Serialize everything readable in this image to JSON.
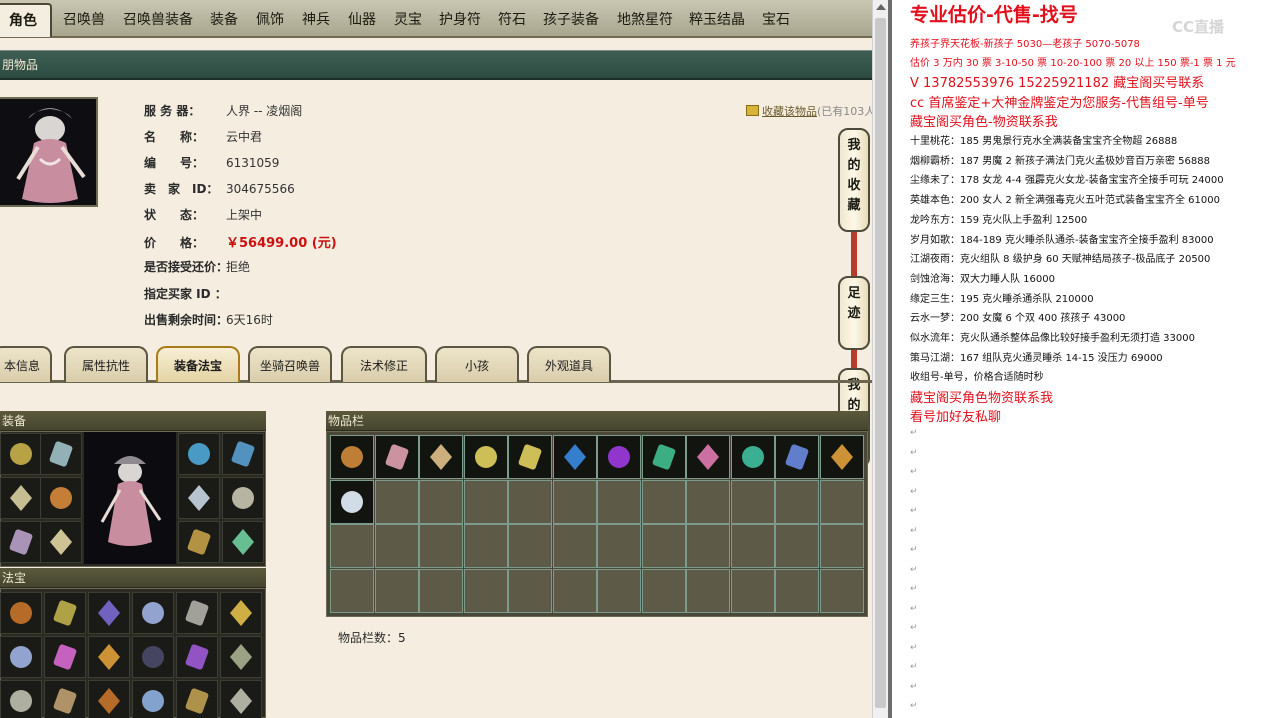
{
  "nav": {
    "items": [
      "角色",
      "召唤兽",
      "召唤兽装备",
      "装备",
      "佩饰",
      "神兵",
      "仙器",
      "灵宝",
      "护身符",
      "符石",
      "孩子装备",
      "地煞星符",
      "粹玉结晶",
      "宝石"
    ],
    "active": "角色"
  },
  "section": {
    "title": "朋物品"
  },
  "info": {
    "server_label": "服 务 器：",
    "server": "人界 -- 凌烟阁",
    "name_label": "名　　称：",
    "name": "云中君",
    "id_label": "编　　号：",
    "id": "6131059",
    "seller_label": "卖　家　ID：",
    "seller": "304675566",
    "status_label": "状　　态：",
    "status": "上架中",
    "price_label": "价　　格：",
    "price": "￥56499.00 (元)",
    "bargain_label": "是否接受还价：",
    "bargain": "拒绝",
    "buyer_label": "指定买家 ID ：",
    "buyer": "",
    "remaining_label": "出售剩余时间：",
    "remaining": "6天16时"
  },
  "favorite": {
    "link": "收藏该物品",
    "count": "(已有103人"
  },
  "side_buttons": {
    "fav": "我的收藏",
    "trace": "足迹",
    "offer": "我的还价"
  },
  "subtabs": {
    "items": [
      "本信息",
      "属性抗性",
      "装备法宝",
      "坐骑召唤兽",
      "法术修正",
      "小孩",
      "外观道具"
    ],
    "active": "装备法宝"
  },
  "equip": {
    "title": "装备",
    "magic_title": "法宝"
  },
  "bag": {
    "title": "物品栏",
    "count_label": "物品栏数：5"
  },
  "notes": {
    "title": "专业估价-代售-找号",
    "line1": "养孩子界天花板-新孩子 5030—老孩子 5070-5078",
    "line2": "估价 3 万内 30 票  3-10-50 票  10-20-100 票 20 以上 150 票-1 票 1 元",
    "line3": "V 13782553976    15225921182   藏宝阁买号联系",
    "line4": "cc 首席鉴定+大神金牌鉴定为您服务-代售组号-单号",
    "line5": "藏宝阁买角色-物资联系我",
    "listings": [
      "十里桃花：185 男鬼景行克水全满装备宝宝齐全物超 26888",
      "烟柳霸桥：187 男魔 2 新孩子满法门克火孟极妙音百万亲密 56888",
      "尘缘未了：178 女龙 4-4 强霹克火女龙-装备宝宝齐全接手可玩 24000",
      "英雄本色：200 女人 2 新全满强毒克火五叶范式装备宝宝齐全 61000",
      "龙吟东方：159 克火队上手盈利 12500",
      "岁月如歌：184-189 克火睡杀队通杀-装备宝宝齐全接手盈利 83000",
      "江湖夜雨：克火组队 8 级护身 60 天赋神结局孩子-极品底子 20500",
      "剑蚀沧海：双大力睡人队 16000",
      "缘定三生：195 克火睡杀通杀队 210000",
      "云水一梦：200 女魔 6 个双 400 孩孩子 43000",
      "似水流年：克火队通杀整体品像比较好接手盈利无须打造 33000",
      "策马江湖：167 组队克火通灵睡杀 14-15 没压力 69000",
      "收组号-单号，价格合适随时秒"
    ],
    "footer1": "藏宝阁买角色物资联系我",
    "footer2": "看号加好友私聊"
  },
  "watermark": "CC直播",
  "colors": {
    "accent_red": "#e2101c",
    "panel_bg": "#f4ede0",
    "section_bar": "#2c4a40"
  }
}
